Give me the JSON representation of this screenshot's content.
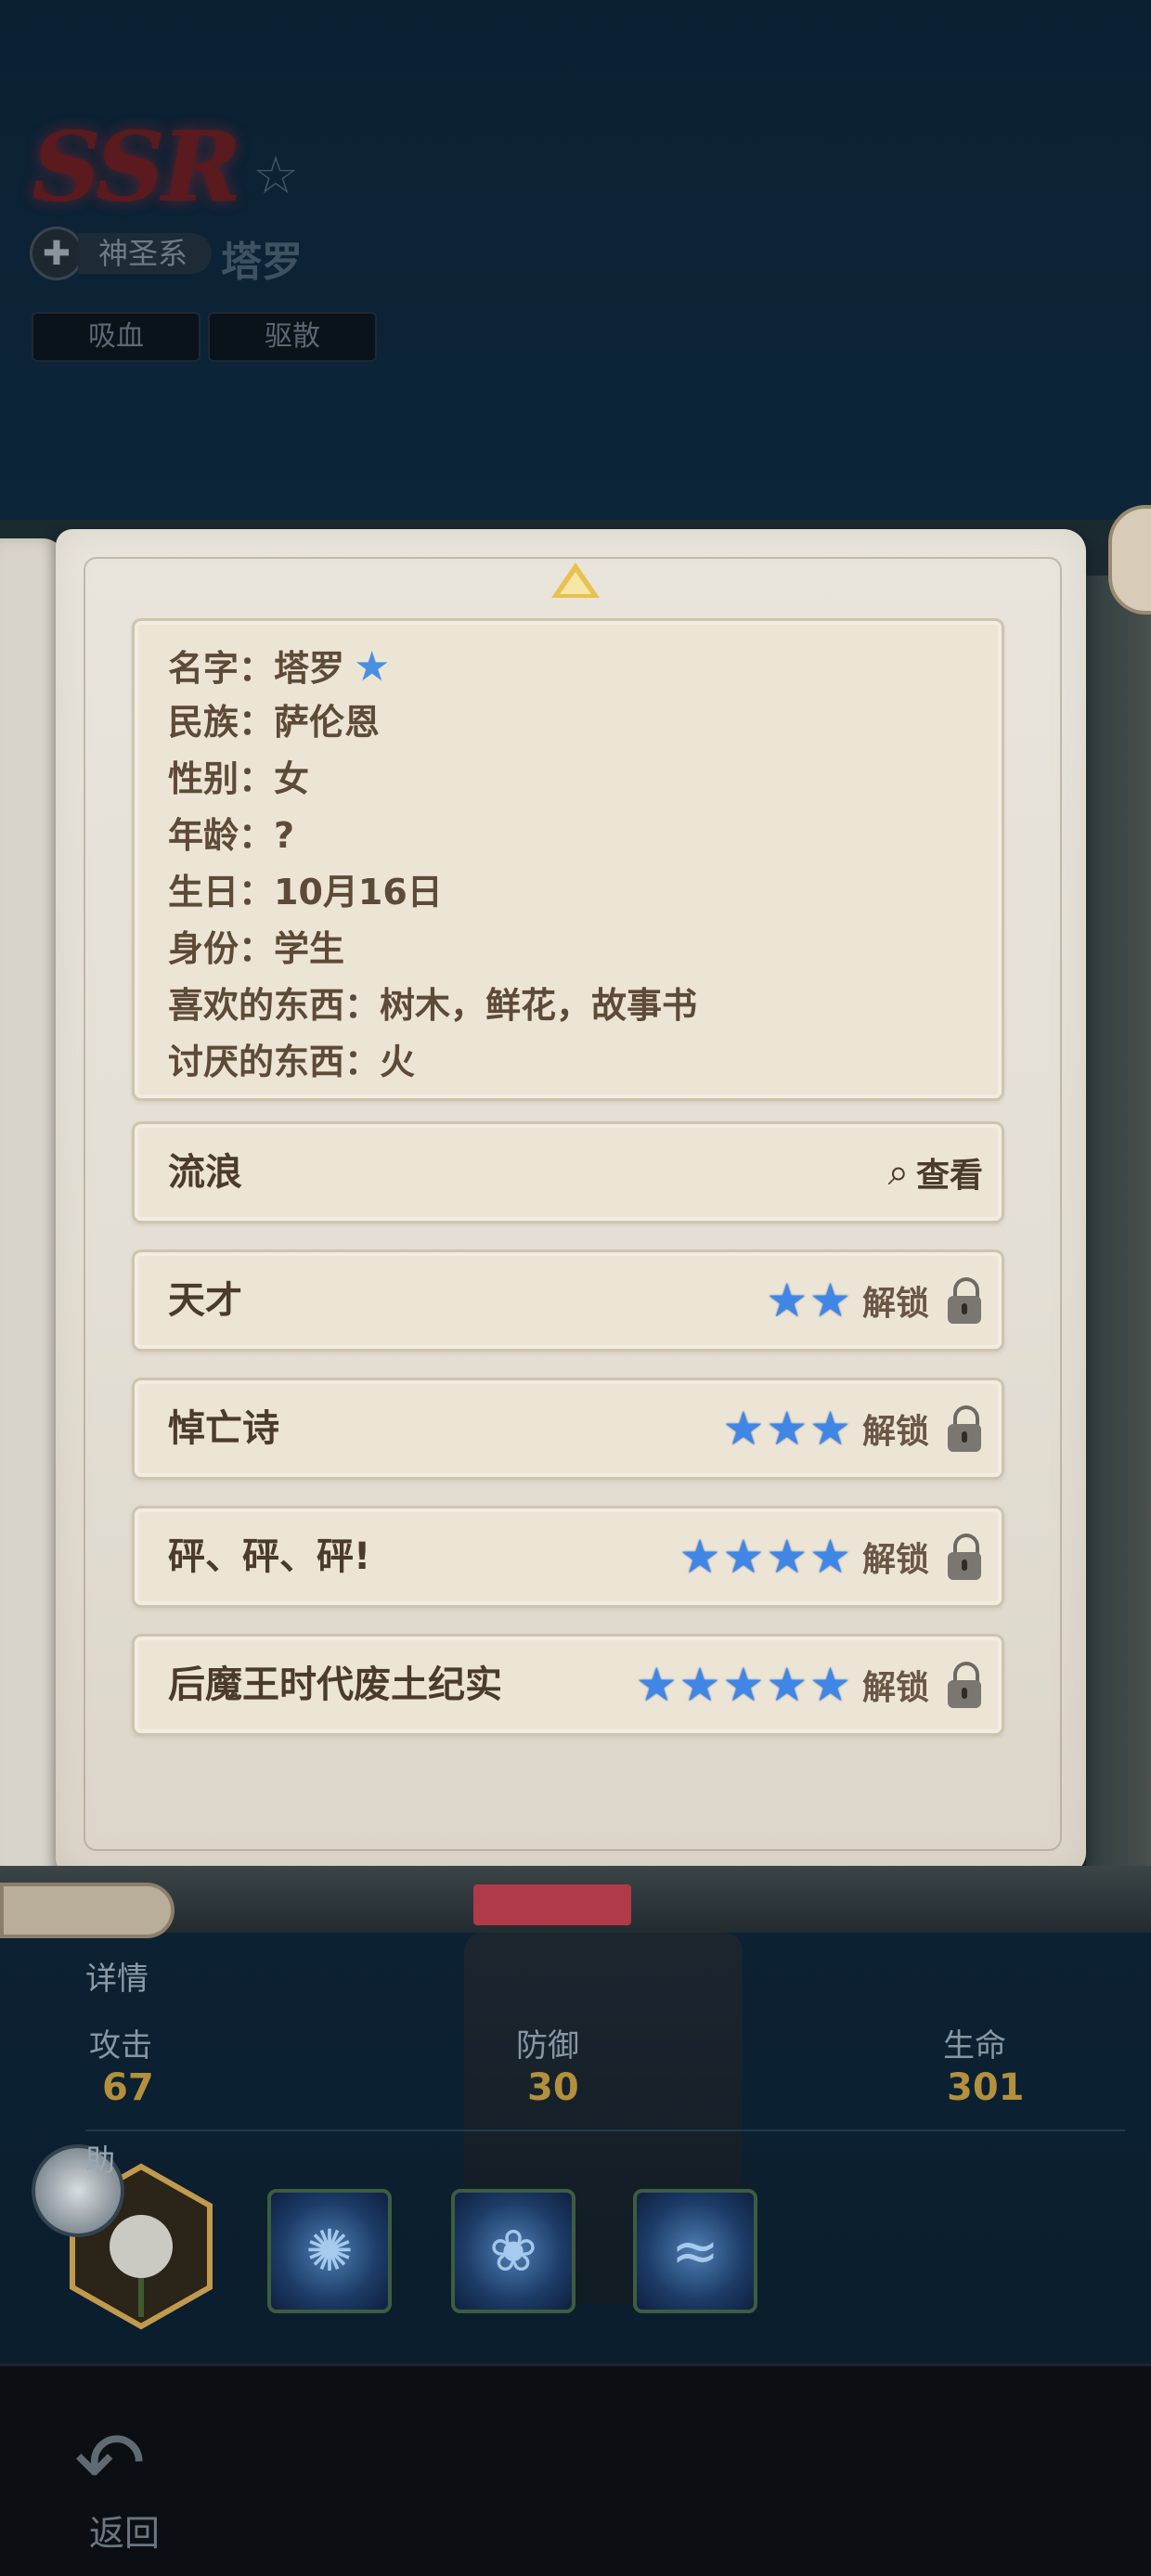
{
  "header": {
    "rarity": "SSR",
    "faction": "神圣系",
    "hero_name": "塔罗",
    "tags": [
      "吸血",
      "驱散"
    ]
  },
  "profile": {
    "name_line": "名字：塔罗",
    "lines": [
      "民族：萨伦恩",
      "性别：女",
      "年龄：?",
      "生日：10月16日",
      "身份：学生",
      "喜欢的东西：树木，鲜花，故事书",
      "讨厌的东西：火"
    ]
  },
  "stories": [
    {
      "title": "流浪",
      "action": "查看",
      "stars": 0,
      "locked": false
    },
    {
      "title": "天才",
      "action": "解锁",
      "stars": 2,
      "locked": true
    },
    {
      "title": "悼亡诗",
      "action": "解锁",
      "stars": 3,
      "locked": true
    },
    {
      "title": "砰、砰、砰!",
      "action": "解锁",
      "stars": 4,
      "locked": true
    },
    {
      "title": "后魔王时代废土纪实",
      "action": "解锁",
      "stars": 5,
      "locked": true
    }
  ],
  "stats": {
    "details_label": "详情",
    "attack_label": "攻击",
    "attack_value": "67",
    "defense_label": "防御",
    "defense_value": "30",
    "hp_label": "生命",
    "hp_value": "301",
    "support_label": "助"
  },
  "nav": {
    "back_label": "返回"
  },
  "colors": {
    "star_blue": "#3f86e6",
    "page": "#e9e5dc",
    "stat_gold": "#b2903d"
  }
}
